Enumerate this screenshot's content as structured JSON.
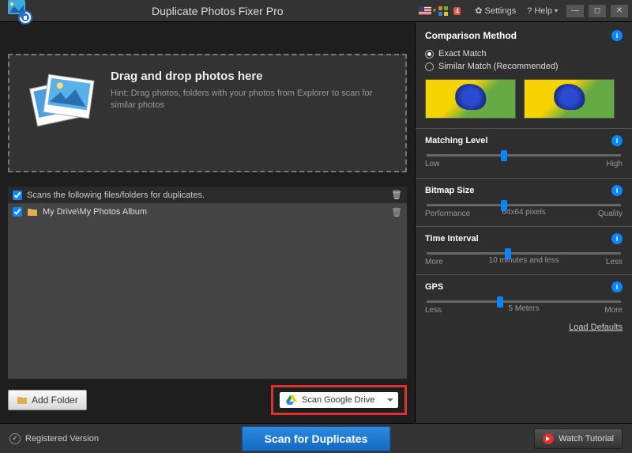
{
  "titlebar": {
    "app_title": "Duplicate Photos Fixer Pro",
    "settings": "Settings",
    "help": "Help",
    "notif_count": "4"
  },
  "dropzone": {
    "title": "Drag and drop photos here",
    "hint": "Hint: Drag photos, folders with your photos from Explorer to scan for similar photos"
  },
  "list": {
    "header": "Scans the following files/folders for duplicates.",
    "items": [
      {
        "path": "My Drive\\My Photos Album"
      }
    ]
  },
  "buttons": {
    "add_folder": "Add Folder",
    "scan_google": "Scan Google Drive",
    "scan": "Scan for Duplicates",
    "watch": "Watch Tutorial"
  },
  "sidebar": {
    "comparison_method": "Comparison Method",
    "exact_match": "Exact Match",
    "similar_match": "Similar Match (Recommended)",
    "matching_level": {
      "title": "Matching Level",
      "left": "Low",
      "right": "High",
      "pos": 40
    },
    "bitmap_size": {
      "title": "Bitmap Size",
      "left": "Performance",
      "right": "Quality",
      "center": "64x64 pixels",
      "pos": 40
    },
    "time_interval": {
      "title": "Time Interval",
      "left": "More",
      "right": "Less",
      "center": "10 minutes and less",
      "pos": 42
    },
    "gps": {
      "title": "GPS",
      "left": "Less",
      "right": "More",
      "center": "5 Meters",
      "pos": 38
    },
    "load_defaults": "Load Defaults"
  },
  "footer": {
    "registered": "Registered Version"
  }
}
